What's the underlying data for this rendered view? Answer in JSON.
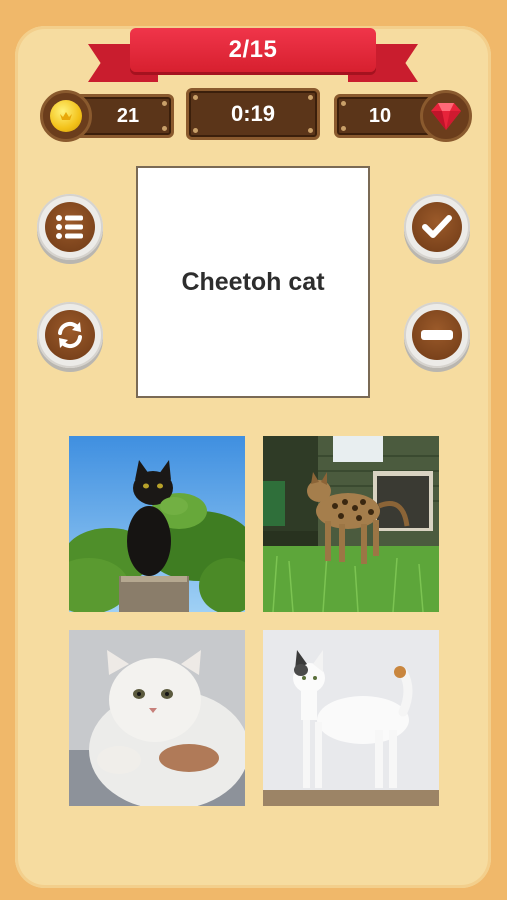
{
  "progress": {
    "label": "2/15"
  },
  "hud": {
    "coins": "21",
    "timer": "0:19",
    "gems": "10"
  },
  "question": {
    "word": "Cheetoh cat"
  },
  "buttons": {
    "list": "list-icon",
    "refresh": "refresh-icon",
    "confirm": "checkmark-icon",
    "remove": "minus-icon"
  },
  "options": [
    {
      "name": "black-cat-photo"
    },
    {
      "name": "spotted-cat-photo"
    },
    {
      "name": "persian-cat-photo"
    },
    {
      "name": "white-cat-photo"
    }
  ],
  "colors": {
    "background": "#f0b86a",
    "panel": "#f6dca0",
    "ribbon": "#e12b3e",
    "hud": "#5b3519"
  }
}
